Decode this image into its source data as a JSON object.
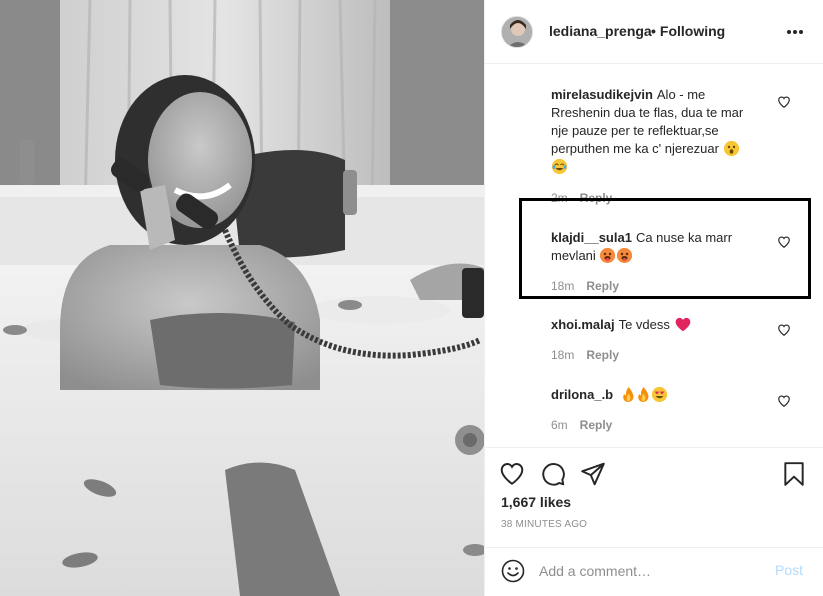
{
  "post": {
    "photo_alt": "black and white photo",
    "header": {
      "username": "lediana_prenga",
      "follow_status": "Following",
      "dot": "•",
      "more_icon": "more-horizontal-icon"
    },
    "comments": [
      {
        "username": "mirelasudikejvin",
        "text_line1": "Alo - me",
        "text_line2": "Rreshenin dua te flas, dua te mar",
        "text_line3": "nje pauze per te reflektuar,se",
        "text_line4": "perputhen me ka c' njerezuar",
        "time": "2m",
        "reply_label": "Reply"
      },
      {
        "username": "klajdi__sula1",
        "text_line1": "Ca nuse ka marr",
        "text_line2": "mevlani",
        "time": "18m",
        "reply_label": "Reply",
        "highlighted": true
      },
      {
        "username": "xhoi.malaj",
        "text": "Te vdess",
        "time": "18m",
        "reply_label": "Reply"
      },
      {
        "username": "drilona_.b",
        "text": "",
        "time": "6m",
        "reply_label": "Reply"
      }
    ],
    "actions": {
      "like_icon": "heart-icon",
      "comment_icon": "comment-icon",
      "share_icon": "paper-plane-icon",
      "save_icon": "bookmark-icon"
    },
    "likes": "1,667 likes",
    "time_ago": "38 MINUTES AGO",
    "add_comment": {
      "placeholder": "Add a comment…",
      "post_label": "Post"
    }
  },
  "colors": {
    "text": "#262626",
    "secondary": "#8e8e8e",
    "border": "#efefef",
    "post_disabled": "#b3dbff",
    "highlight_border": "#000000"
  }
}
